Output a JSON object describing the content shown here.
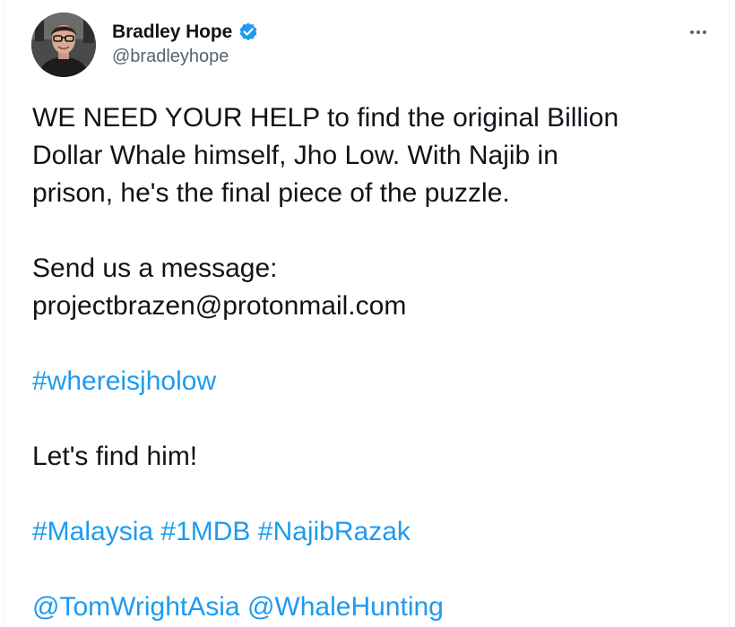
{
  "tweet": {
    "author": {
      "display_name": "Bradley Hope",
      "handle": "@bradleyhope",
      "verified": true
    },
    "more_icon": "ellipsis-icon",
    "text": {
      "line1": "WE NEED YOUR HELP to find the original Billion",
      "line2": "Dollar Whale himself, Jho Low. With Najib in",
      "line3": "prison, he's the final piece of the puzzle.",
      "line4": "Send us a message:",
      "line5": "projectbrazen@protonmail.com",
      "hashtag_whereisjholow": "#whereisjholow",
      "line7": "Let's find him!",
      "hashtag_malaysia": "#Malaysia",
      "hashtag_1mdb": "#1MDB",
      "hashtag_najibrazak": "#NajibRazak",
      "mention_tomwrightasia": "@TomWrightAsia",
      "mention_whalehunting": "@WhaleHunting"
    },
    "colors": {
      "link": "#1d9bf0",
      "text": "#0f1419",
      "secondary": "#536471",
      "verified": "#1d9bf0"
    }
  }
}
